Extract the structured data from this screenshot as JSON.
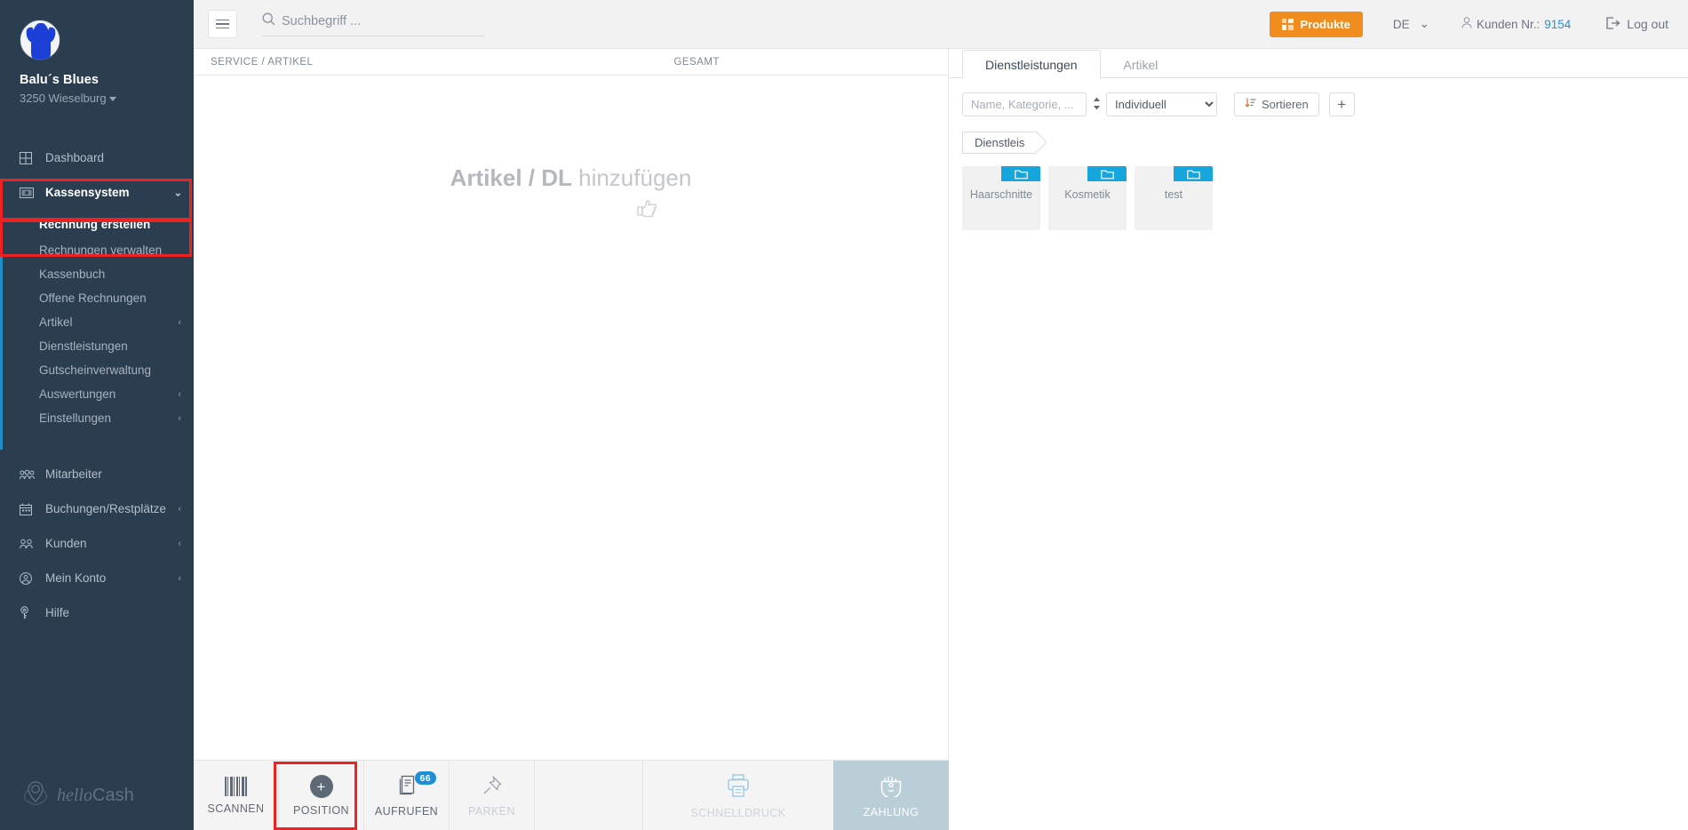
{
  "brand": {
    "name": "Balu´s Blues",
    "location": "3250 Wieselburg",
    "avatar_icon": "dog-avatar-icon"
  },
  "sidebar": {
    "items": [
      {
        "label": "Dashboard",
        "icon": "grid-icon",
        "chevron": ""
      },
      {
        "label": "Kassensystem",
        "icon": "cash-note-icon",
        "chevron": "down"
      },
      {
        "label": "Mitarbeiter",
        "icon": "employees-icon",
        "chevron": ""
      },
      {
        "label": "Buchungen/Restplätze",
        "icon": "calendar-icon",
        "chevron": "right"
      },
      {
        "label": "Kunden",
        "icon": "customers-icon",
        "chevron": "right"
      },
      {
        "label": "Mein Konto",
        "icon": "account-circle-icon",
        "chevron": "right"
      },
      {
        "label": "Hilfe",
        "icon": "help-key-icon",
        "chevron": ""
      }
    ],
    "submenu": [
      {
        "label": "Rechnung erstellen",
        "chevron": "",
        "active": true
      },
      {
        "label": "Rechnungen verwalten",
        "chevron": ""
      },
      {
        "label": "Kassenbuch",
        "chevron": ""
      },
      {
        "label": "Offene Rechnungen",
        "chevron": ""
      },
      {
        "label": "Artikel",
        "chevron": "right"
      },
      {
        "label": "Dienstleistungen",
        "chevron": ""
      },
      {
        "label": "Gutscheinverwaltung",
        "chevron": ""
      },
      {
        "label": "Auswertungen",
        "chevron": "right"
      },
      {
        "label": "Einstellungen",
        "chevron": "right"
      }
    ],
    "footer_logo": {
      "script_part": "hello",
      "plain_part": "Cash"
    },
    "accent_color": "#1d8fc4"
  },
  "highlight": {
    "color": "#ee2222"
  },
  "topbar": {
    "menu_toggle_icon": "hamburger-icon",
    "search": {
      "placeholder": "Suchbegriff ...",
      "value": "",
      "icon": "search-icon"
    },
    "produkte_label": "Produkte",
    "produkte_color": "#f08d1e",
    "language": "DE",
    "customer_label": "Kunden Nr.:",
    "customer_number": "9154",
    "logout_label": "Log out"
  },
  "cart": {
    "col_service": "SERVICE / ARTIKEL",
    "col_total": "GESAMT",
    "empty_bold": "Artikel / DL",
    "empty_rest": " hinzufügen",
    "hand_icon": "pointing-hand-icon"
  },
  "catalog": {
    "tabs": [
      {
        "label": "Dienstleistungen",
        "active": true
      },
      {
        "label": "Artikel",
        "active": false
      }
    ],
    "filter": {
      "name_placeholder": "Name, Kategorie, ...",
      "name_value": "",
      "sort_toggle_icon": "sort-updown-icon",
      "category_selected": "Individuell",
      "category_options": [
        "Individuell"
      ],
      "sort_label": "Sortieren",
      "sort_icon": "sort-descending-icon",
      "add_label": "+"
    },
    "breadcrumb": "Dienstleis",
    "folders": [
      {
        "name": "Haarschnitte",
        "icon": "folder-icon"
      },
      {
        "name": "Kosmetik",
        "icon": "folder-icon"
      },
      {
        "name": "test",
        "icon": "folder-icon"
      }
    ],
    "folder_badge_color": "#17a5dd"
  },
  "bottombar": {
    "buttons": [
      {
        "label": "SCANNEN",
        "icon": "barcode-icon",
        "state": "enabled"
      },
      {
        "label": "POSITION",
        "icon": "plus-circle-icon",
        "state": "enabled"
      },
      {
        "label": "AUFRUFEN",
        "icon": "documents-icon",
        "state": "enabled",
        "badge": "66"
      },
      {
        "label": "PARKEN",
        "icon": "pin-icon",
        "state": "disabled"
      },
      {
        "label": "SCHNELLDRUCK",
        "icon": "printer-icon",
        "state": "disabled"
      },
      {
        "label": "ZAHLUNG",
        "icon": "payment-hand-icon",
        "state": "primary"
      }
    ]
  }
}
